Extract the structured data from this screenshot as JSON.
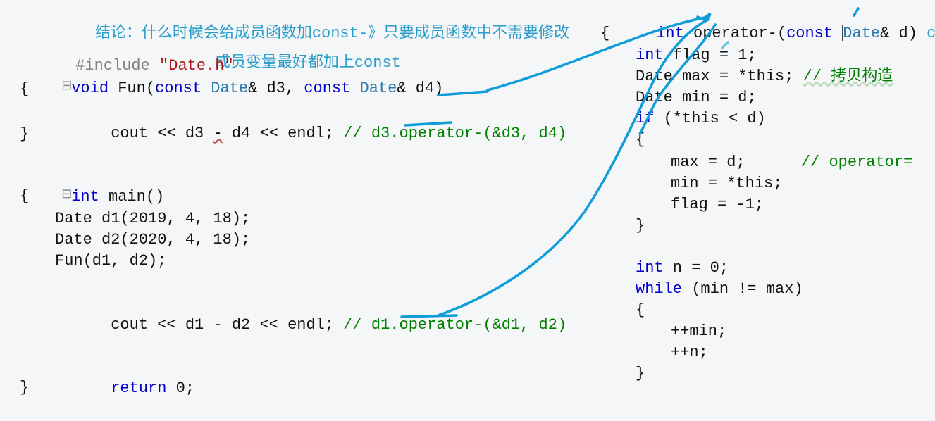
{
  "annotation": {
    "line1_part1": "结论：什么时候会给成员函数加const-》只要成员函数中不需要修改",
    "line2": "成员变量最好都加上const"
  },
  "left": {
    "include_kw": "#include",
    "include_header": "\"Date.h\"",
    "void_kw": "void",
    "fun_name": "Fun",
    "const_kw": "const",
    "date_cls": "Date",
    "amp": "&",
    "p1": "d3",
    "p2": "d4",
    "cout": "cout",
    "d3": "d3",
    "minus": "-",
    "d4": "d4",
    "endl": "endl",
    "cmt1": "// d3.operator-(&d3, d4)",
    "int_kw": "int",
    "main": "main",
    "d1_line": "Date d1(2019, 4, 18);",
    "d2_line": "Date d2(2020, 4, 18);",
    "fun_call": "Fun(d1, d2);",
    "d1": "d1",
    "d2": "d2",
    "cmt2": "// d1.operator-(&d1, d2)",
    "return_kw": "return",
    "zero": "0"
  },
  "right": {
    "int_kw": "int",
    "operator_sig1": "operator-",
    "const_kw": "const",
    "date_cls": "Date",
    "param": "d",
    "flag_decl1": "int",
    "flag_decl2": " flag = 1;",
    "max_decl": "Date max = *this;",
    "max_cmt": "// 拷贝构造",
    "min_decl": "Date min = d;",
    "if_kw": "if",
    "if_cond": " (*this < d)",
    "max_assign": "max = d;",
    "max_assign_cmt": "// operator=",
    "min_assign": "min = *this;",
    "flag_assign": "flag = -1;",
    "n_decl": "int n = 0;",
    "while_kw": "while",
    "while_cond": " (min != max)",
    "inc_min": "++min;",
    "inc_n": "++n;"
  },
  "code_fold_glyph": "⊟"
}
